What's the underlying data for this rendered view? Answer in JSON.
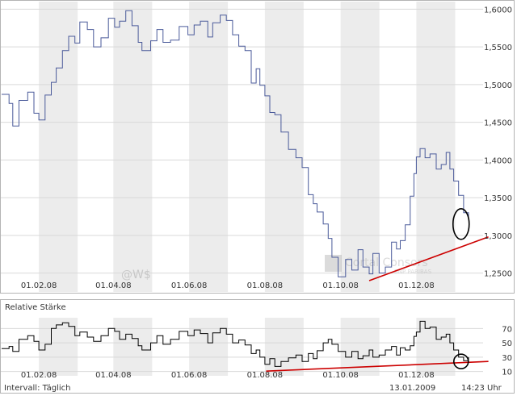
{
  "chart_data": [
    {
      "type": "line",
      "title": "",
      "x_tick_labels": [
        "01.02.08",
        "01.04.08",
        "01.06.08",
        "01.08.08",
        "01.10.08",
        "01.12.08"
      ],
      "y_tick_labels": [
        "1,6000",
        "1,5500",
        "1,5000",
        "1,4500",
        "1,4000",
        "1,3500",
        "1,3000",
        "1,2500"
      ],
      "ylim": [
        1.225,
        1.61
      ],
      "grid": true,
      "x_dates": [
        "2008-01-02",
        "2008-01-08",
        "2008-01-11",
        "2008-01-16",
        "2008-01-23",
        "2008-01-28",
        "2008-02-01",
        "2008-02-06",
        "2008-02-11",
        "2008-02-15",
        "2008-02-20",
        "2008-02-25",
        "2008-03-01",
        "2008-03-05",
        "2008-03-11",
        "2008-03-16",
        "2008-03-22",
        "2008-03-28",
        "2008-04-02",
        "2008-04-06",
        "2008-04-11",
        "2008-04-16",
        "2008-04-21",
        "2008-04-24",
        "2008-05-01",
        "2008-05-06",
        "2008-05-11",
        "2008-05-17",
        "2008-05-24",
        "2008-05-31",
        "2008-06-05",
        "2008-06-10",
        "2008-06-16",
        "2008-06-20",
        "2008-06-26",
        "2008-07-01",
        "2008-07-06",
        "2008-07-11",
        "2008-07-16",
        "2008-07-21",
        "2008-07-25",
        "2008-07-28",
        "2008-08-01",
        "2008-08-05",
        "2008-08-09",
        "2008-08-14",
        "2008-08-20",
        "2008-08-26",
        "2008-08-31",
        "2008-09-05",
        "2008-09-09",
        "2008-09-12",
        "2008-09-17",
        "2008-09-21",
        "2008-09-24",
        "2008-09-29",
        "2008-10-05",
        "2008-10-10",
        "2008-10-15",
        "2008-10-19",
        "2008-10-24",
        "2008-10-27",
        "2008-11-01",
        "2008-11-06",
        "2008-11-11",
        "2008-11-15",
        "2008-11-18",
        "2008-11-22",
        "2008-11-26",
        "2008-11-29",
        "2008-12-01",
        "2008-12-04",
        "2008-12-08",
        "2008-12-12",
        "2008-12-17",
        "2008-12-21",
        "2008-12-25",
        "2008-12-28",
        "2008-12-31",
        "2009-01-04",
        "2009-01-08",
        "2009-01-12"
      ],
      "series": [
        {
          "color": "#4a5a9a",
          "values": [
            1.487,
            1.475,
            1.445,
            1.479,
            1.49,
            1.462,
            1.453,
            1.486,
            1.503,
            1.522,
            1.545,
            1.564,
            1.555,
            1.583,
            1.573,
            1.55,
            1.562,
            1.588,
            1.576,
            1.584,
            1.598,
            1.578,
            1.556,
            1.545,
            1.558,
            1.573,
            1.556,
            1.559,
            1.577,
            1.566,
            1.579,
            1.584,
            1.563,
            1.582,
            1.592,
            1.585,
            1.566,
            1.551,
            1.545,
            1.502,
            1.521,
            1.499,
            1.485,
            1.463,
            1.46,
            1.437,
            1.414,
            1.403,
            1.39,
            1.354,
            1.342,
            1.331,
            1.315,
            1.296,
            1.271,
            1.245,
            1.268,
            1.254,
            1.281,
            1.258,
            1.249,
            1.276,
            1.25,
            1.258,
            1.291,
            1.282,
            1.293,
            1.314,
            1.352,
            1.382,
            1.404,
            1.415,
            1.403,
            1.408,
            1.388,
            1.394,
            1.41,
            1.388,
            1.372,
            1.353,
            1.33,
            1.322
          ]
        }
      ],
      "trendline_color": "#cc0000",
      "trendline": {
        "x": [
          "2008-10-24",
          "2009-01-28"
        ],
        "y": [
          1.24,
          1.298
        ]
      },
      "circle_marker": {
        "x": "2009-01-06",
        "y": 1.315
      },
      "watermark": "@W$",
      "watermark_logo": "Cortal Consors BNP PARIBAS"
    },
    {
      "type": "line",
      "title": "Relative Stärke",
      "x_tick_labels": [
        "01.02.08",
        "01.04.08",
        "01.06.08",
        "01.08.08",
        "01.10.08",
        "01.12.08"
      ],
      "y_tick_labels": [
        "70",
        "50",
        "30",
        "10"
      ],
      "ylim": [
        4,
        85
      ],
      "grid": true,
      "series": [
        {
          "color": "#000000",
          "values": [
            42,
            45,
            38,
            55,
            60,
            52,
            40,
            48,
            70,
            75,
            78,
            73,
            60,
            65,
            58,
            52,
            60,
            70,
            66,
            55,
            62,
            56,
            46,
            40,
            50,
            60,
            48,
            55,
            66,
            60,
            68,
            63,
            50,
            64,
            70,
            62,
            50,
            54,
            47,
            35,
            40,
            30,
            20,
            28,
            17,
            24,
            29,
            33,
            24,
            35,
            28,
            39,
            50,
            55,
            48,
            38,
            30,
            38,
            28,
            32,
            40,
            30,
            33,
            40,
            45,
            33,
            43,
            40,
            46,
            59,
            65,
            80,
            70,
            72,
            55,
            58,
            62,
            50,
            40,
            30,
            25,
            30
          ]
        }
      ],
      "trendline": {
        "x": [
          "2008-08-02",
          "2009-01-28"
        ],
        "y": [
          10.5,
          24
        ]
      },
      "circle_marker": {
        "x": "2009-01-06",
        "y": 24
      }
    }
  ],
  "footer": {
    "interval": "Intervall: Täglich",
    "date": "13.01.2009",
    "time": "14:23 Uhr"
  }
}
